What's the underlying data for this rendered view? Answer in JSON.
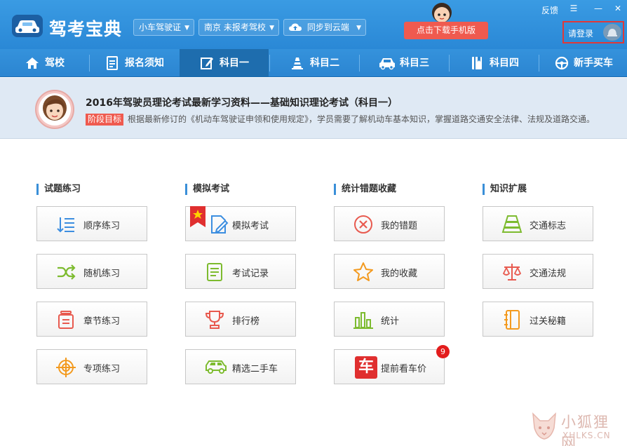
{
  "app": {
    "title": "驾考宝典",
    "license_select": "小车驾驶证",
    "location_select": "南京 未报考驾校",
    "sync_select": "同步到云端",
    "download_button": "点击下载手机版",
    "feedback_link": "反馈",
    "login_text": "请登录"
  },
  "nav": {
    "items": [
      {
        "label": "驾校",
        "icon": "home-icon"
      },
      {
        "label": "报名须知",
        "icon": "document-icon"
      },
      {
        "label": "科目一",
        "icon": "edit-icon",
        "active": true
      },
      {
        "label": "科目二",
        "icon": "cone-icon"
      },
      {
        "label": "科目三",
        "icon": "car-icon"
      },
      {
        "label": "科目四",
        "icon": "book-icon"
      },
      {
        "label": "新手买车",
        "icon": "steering-wheel-icon"
      }
    ]
  },
  "banner": {
    "title": "2016年驾驶员理论考试最新学习资料——基础知识理论考试（科目一）",
    "tag": "阶段目标",
    "description": "根据最新修订的《机动车驾驶证申领和使用规定》，学员需要了解机动车基本知识，掌握道路交通安全法律、法规及道路交通。"
  },
  "sections": [
    {
      "title": "试题练习",
      "cards": [
        {
          "label": "顺序练习",
          "icon": "ordered-list-icon"
        },
        {
          "label": "随机练习",
          "icon": "shuffle-icon"
        },
        {
          "label": "章节练习",
          "icon": "chapter-icon"
        },
        {
          "label": "专项练习",
          "icon": "target-icon"
        }
      ]
    },
    {
      "title": "模拟考试",
      "cards": [
        {
          "label": "模拟考试",
          "icon": "exam-edit-icon"
        },
        {
          "label": "考试记录",
          "icon": "record-icon"
        },
        {
          "label": "排行榜",
          "icon": "trophy-icon"
        },
        {
          "label": "精选二手车",
          "icon": "used-car-icon"
        }
      ]
    },
    {
      "title": "统计错题收藏",
      "cards": [
        {
          "label": "我的错题",
          "icon": "wrong-icon"
        },
        {
          "label": "我的收藏",
          "icon": "star-icon"
        },
        {
          "label": "统计",
          "icon": "bar-chart-icon"
        },
        {
          "label": "提前看车价",
          "icon": "car-price-icon",
          "badge": "9"
        }
      ]
    },
    {
      "title": "知识扩展",
      "cards": [
        {
          "label": "交通标志",
          "icon": "traffic-sign-icon"
        },
        {
          "label": "交通法规",
          "icon": "scales-icon"
        },
        {
          "label": "过关秘籍",
          "icon": "notebook-icon"
        }
      ]
    }
  ],
  "car_icon_char": "车",
  "watermark": {
    "line1": "小狐狸网",
    "line2": "XHLKS.CN"
  },
  "colors": {
    "header_blue": "#2a88d6",
    "accent_red": "#ef5a4f",
    "badge_red": "#e31c1c"
  }
}
